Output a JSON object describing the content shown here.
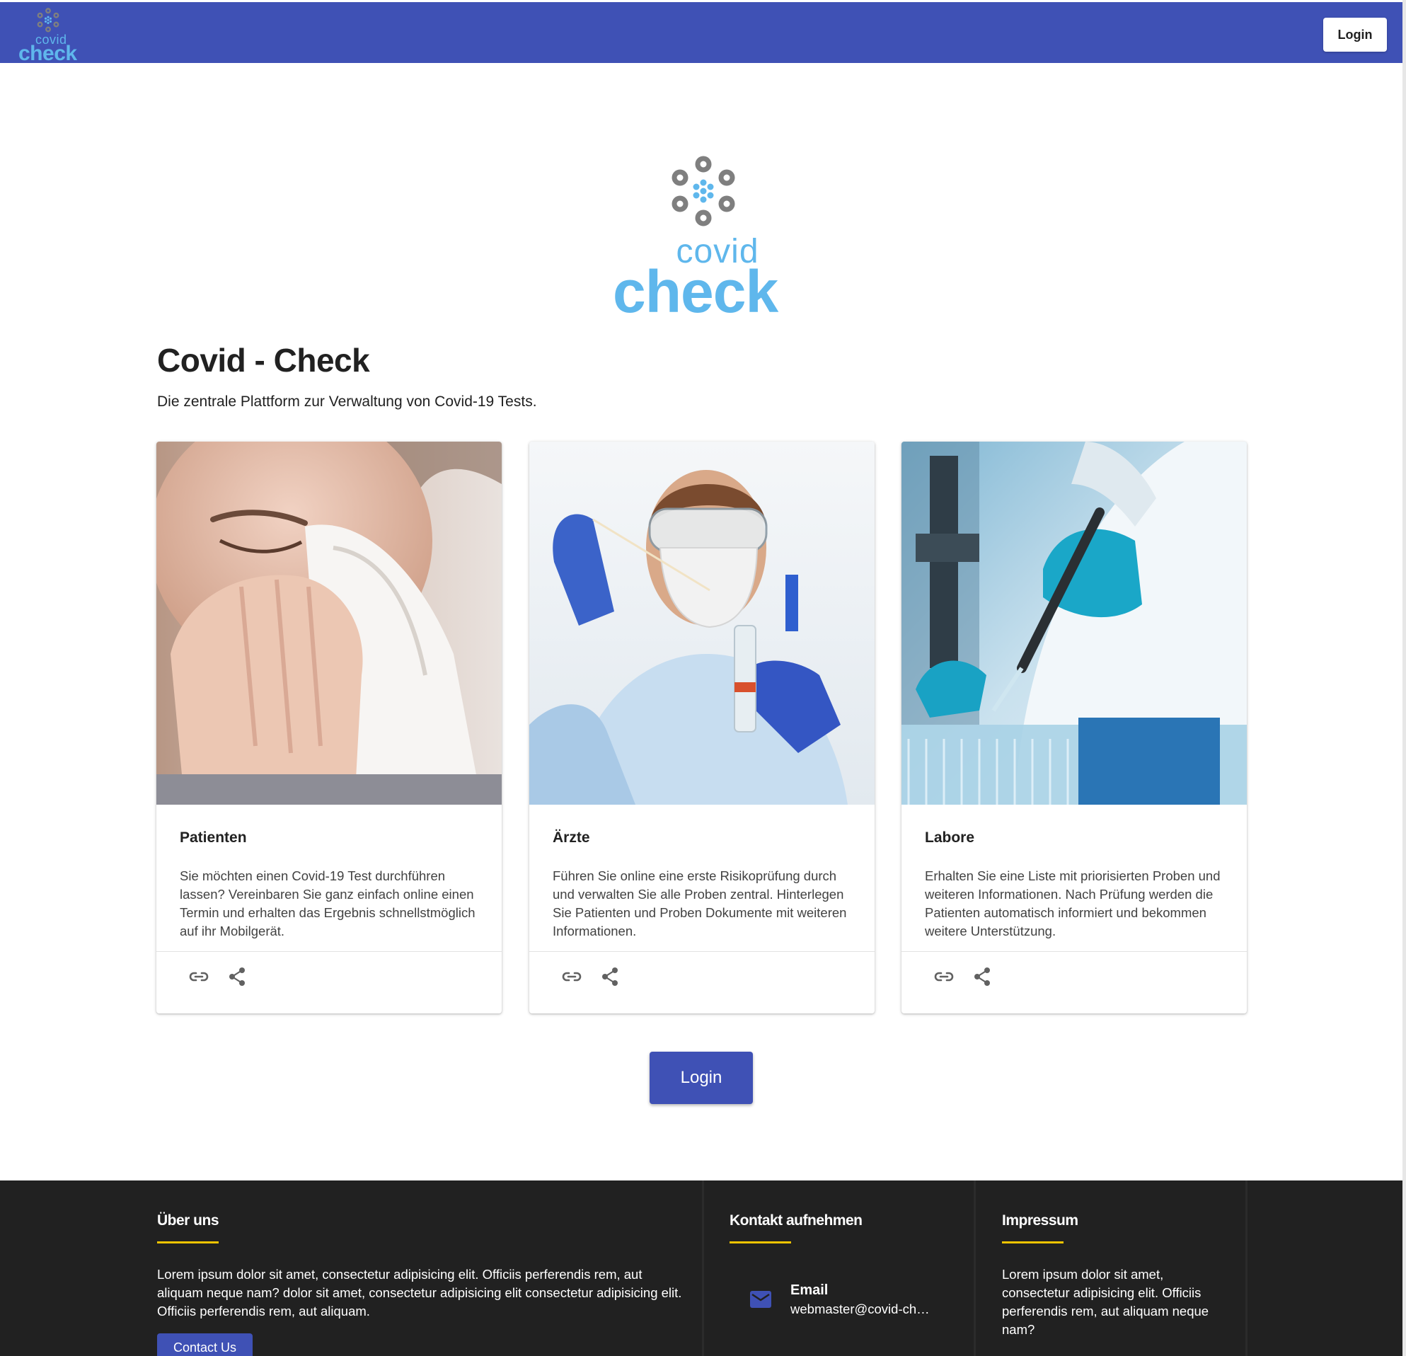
{
  "header": {
    "logo": {
      "word_small": "covid",
      "word_big": "check"
    },
    "login_label": "Login"
  },
  "hero": {
    "logo": {
      "word_small": "covid",
      "word_big": "check"
    },
    "title": "Covid - Check",
    "subtitle": "Die zentrale Plattform zur Verwaltung von Covid-19 Tests."
  },
  "cards": [
    {
      "image": "woman-sneezing-photo",
      "title": "Patienten",
      "text": "Sie möchten einen Covid-19 Test durchführen lassen? Vereinbaren Sie ganz einfach online einen Termin und erhalten das Ergebnis schnellstmöglich auf ihr Mobilgerät.",
      "icons": [
        "link-icon",
        "share-icon"
      ]
    },
    {
      "image": "doctor-swab-test-photo",
      "title": "Ärzte",
      "text": "Führen Sie online eine erste Risikoprüfung durch und verwalten Sie alle Proben zentral. Hinterlegen Sie Patienten und Proben Dokumente mit weiteren Informationen.",
      "icons": [
        "link-icon",
        "share-icon"
      ]
    },
    {
      "image": "lab-pipette-photo",
      "title": "Labore",
      "text": "Erhalten Sie eine Liste mit priorisierten Proben und weiteren Informationen. Nach Prüfung werden die Patienten automatisch informiert und bekommen weitere Unterstützung.",
      "icons": [
        "link-icon",
        "share-icon"
      ]
    }
  ],
  "main_login_label": "Login",
  "footer": {
    "about": {
      "heading": "Über uns",
      "text": "Lorem ipsum dolor sit amet, consectetur adipisicing elit. Officiis perferendis rem, aut aliquam neque nam? dolor sit amet, consectetur adipisicing elit consectetur adipisicing elit. Officiis perferendis rem, aut aliquam.",
      "button_label": "Contact Us"
    },
    "contact": {
      "heading": "Kontakt aufnehmen",
      "email_label": "Email",
      "email_value": "webmaster@covid-check.de",
      "icon": "mail-icon"
    },
    "imprint": {
      "heading": "Impressum",
      "text": "Lorem ipsum dolor sit amet, consectetur adipisicing elit. Officiis perferendis rem, aut aliquam neque nam?"
    }
  },
  "colors": {
    "primary": "#3f51b5",
    "logo_blue": "#5fb7ec",
    "logo_gray": "#7f7f7f",
    "footer_bg": "#212121",
    "footer_accent": "#f2c400"
  }
}
